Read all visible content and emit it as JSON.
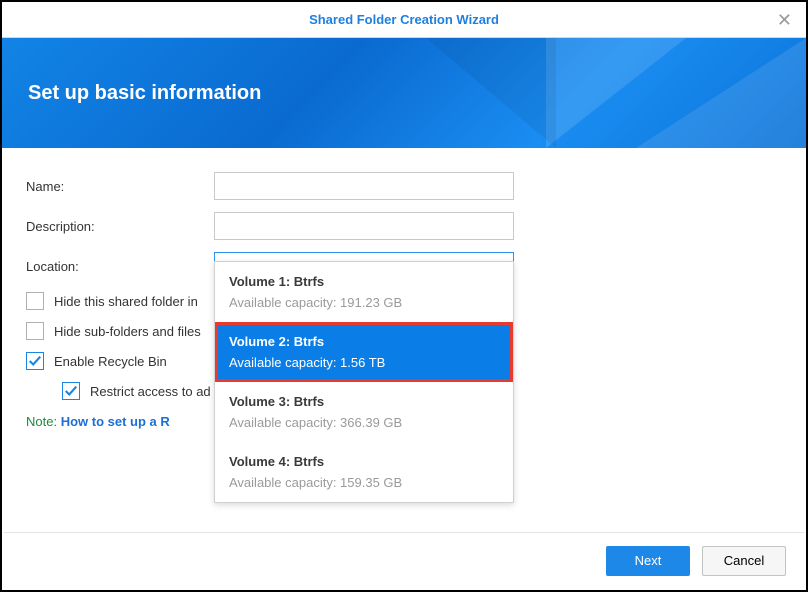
{
  "title": "Shared Folder Creation Wizard",
  "banner_title": "Set up basic information",
  "labels": {
    "name": "Name:",
    "description": "Description:",
    "location": "Location:"
  },
  "inputs": {
    "name": {
      "value": "",
      "placeholder": ""
    },
    "description": {
      "value": "",
      "placeholder": ""
    }
  },
  "location_select": {
    "selected_label": "Volume 2:  Btrfs",
    "options": [
      {
        "title": "Volume 1: Btrfs",
        "sub": "Available capacity: 191.23 GB",
        "selected": false
      },
      {
        "title": "Volume 2: Btrfs",
        "sub": "Available capacity: 1.56 TB",
        "selected": true
      },
      {
        "title": "Volume 3: Btrfs",
        "sub": "Available capacity: 366.39 GB",
        "selected": false
      },
      {
        "title": "Volume 4: Btrfs",
        "sub": "Available capacity: 159.35 GB",
        "selected": false
      }
    ]
  },
  "checks": {
    "hide_folder": {
      "label": "Hide this shared folder in",
      "checked": false
    },
    "hide_sub": {
      "label": "Hide sub-folders and files",
      "checked": false
    },
    "recycle_bin": {
      "label": "Enable Recycle Bin",
      "checked": true
    },
    "restrict_access": {
      "label": "Restrict access to ad",
      "checked": true
    }
  },
  "note": {
    "prefix": "Note:",
    "link": "How to set up a R"
  },
  "buttons": {
    "next": "Next",
    "cancel": "Cancel"
  }
}
